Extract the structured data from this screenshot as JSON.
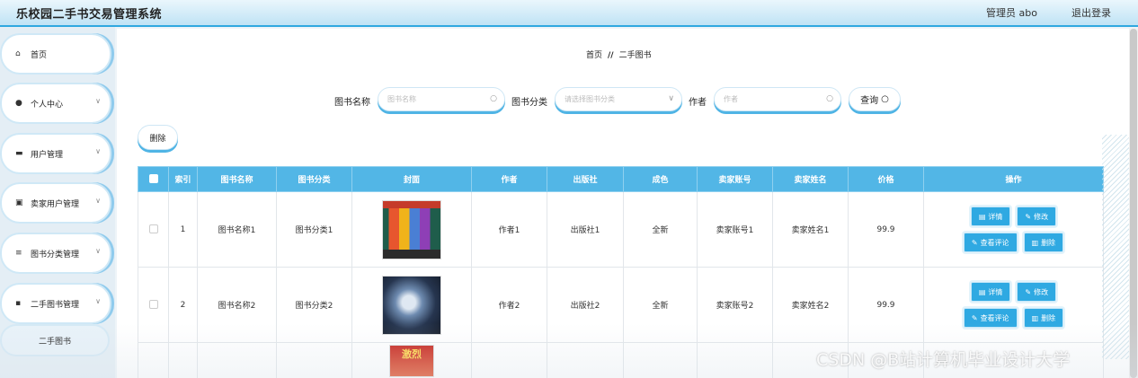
{
  "app": {
    "title": "乐校园二手书交易管理系统",
    "admin_label": "管理员 abo",
    "logout_label": "退出登录"
  },
  "sidebar": {
    "items": [
      {
        "label": "首页",
        "icon": "home-icon",
        "glyph": "⌂"
      },
      {
        "label": "个人中心",
        "icon": "person-icon",
        "glyph": "●"
      },
      {
        "label": "用户管理",
        "icon": "monitor-icon",
        "glyph": "▬"
      },
      {
        "label": "卖家用户管理",
        "icon": "image-icon",
        "glyph": "▣"
      },
      {
        "label": "图书分类管理",
        "icon": "list-icon",
        "glyph": "≡"
      },
      {
        "label": "二手图书管理",
        "icon": "grid-icon",
        "glyph": "▪"
      }
    ],
    "sub_item": "二手图书"
  },
  "breadcrumb": {
    "home": "首页",
    "separator": "//",
    "current": "二手图书"
  },
  "search": {
    "name_label": "图书名称",
    "name_placeholder": "图书名称",
    "category_label": "图书分类",
    "category_placeholder": "请选择图书分类",
    "author_label": "作者",
    "author_placeholder": "作者",
    "query_label": "查询"
  },
  "toolbar": {
    "delete_label": "删除"
  },
  "table": {
    "headers": [
      "索引",
      "图书名称",
      "图书分类",
      "封面",
      "作者",
      "出版社",
      "成色",
      "卖家账号",
      "卖家姓名",
      "价格",
      "操作"
    ],
    "rows": [
      {
        "index": "1",
        "name": "图书名称1",
        "category": "图书分类1",
        "author": "作者1",
        "publisher": "出版社1",
        "condition": "全新",
        "seller_account": "卖家账号1",
        "seller_name": "卖家姓名1",
        "price": "99.9"
      },
      {
        "index": "2",
        "name": "图书名称2",
        "category": "图书分类2",
        "author": "作者2",
        "publisher": "出版社2",
        "condition": "全新",
        "seller_account": "卖家账号2",
        "seller_name": "卖家姓名2",
        "price": "99.9"
      }
    ],
    "partial_cover_text": "激烈",
    "actions": {
      "detail": "详情",
      "edit": "修改",
      "comments": "查看评论",
      "delete": "删除"
    }
  },
  "watermark": "CSDN @B站计算机毕业设计大学",
  "colors": {
    "accent": "#2fa9e2",
    "header_bg": "#52b6e6"
  }
}
